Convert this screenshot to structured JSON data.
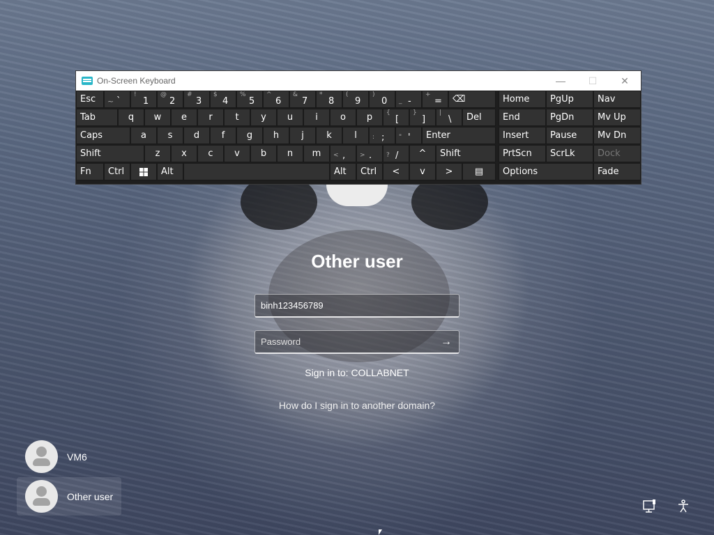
{
  "osk": {
    "title": "On-Screen Keyboard",
    "minimize": "—",
    "maximize": "☐",
    "close": "✕",
    "keys": {
      "esc": "Esc",
      "tilde_sub": "~",
      "tilde_main": "`",
      "k1_sub": "!",
      "k1": "1",
      "k2_sub": "@",
      "k2": "2",
      "k3_sub": "#",
      "k3": "3",
      "k4_sub": "$",
      "k4": "4",
      "k5_sub": "%",
      "k5": "5",
      "k6_sub": "^",
      "k6": "6",
      "k7_sub": "&",
      "k7": "7",
      "k8_sub": "*",
      "k8": "8",
      "k9_sub": "(",
      "k9": "9",
      "k0_sub": ")",
      "k0": "0",
      "minus_sub": "_",
      "minus": "-",
      "equals_sub": "+",
      "equals": "=",
      "backspace": "⌫",
      "home": "Home",
      "pgup": "PgUp",
      "nav": "Nav",
      "tab": "Tab",
      "q": "q",
      "w": "w",
      "e": "e",
      "r": "r",
      "t": "t",
      "y": "y",
      "u": "u",
      "i": "i",
      "o": "o",
      "p": "p",
      "lbracket_sub": "{",
      "lbracket": "[",
      "rbracket_sub": "}",
      "rbracket": "]",
      "pipe_sub": "|",
      "backslash": "\\",
      "del": "Del",
      "end": "End",
      "pgdn": "PgDn",
      "mvup": "Mv Up",
      "caps": "Caps",
      "a": "a",
      "s": "s",
      "d": "d",
      "f": "f",
      "g": "g",
      "h": "h",
      "j": "j",
      "k": "k",
      "l": "l",
      "semi_sub": ":",
      "semi": ";",
      "quote_sub": "\"",
      "quote": "'",
      "enter": "Enter",
      "insert": "Insert",
      "pause": "Pause",
      "mvdn": "Mv Dn",
      "shift": "Shift",
      "z": "z",
      "x": "x",
      "c": "c",
      "v": "v",
      "b": "b",
      "n": "n",
      "m": "m",
      "comma_sub": "<",
      "comma": ",",
      "period_sub": ">",
      "period": ".",
      "slash_sub": "?",
      "slash": "/",
      "up": "^",
      "shift_r": "Shift",
      "prtscn": "PrtScn",
      "scrlk": "ScrLk",
      "dock": "Dock",
      "fn": "Fn",
      "ctrl": "Ctrl",
      "alt": "Alt",
      "alt_r": "Alt",
      "ctrl_r": "Ctrl",
      "left": "<",
      "down": "v",
      "right": ">",
      "menu": "▤",
      "options": "Options",
      "fade": "Fade"
    }
  },
  "signin": {
    "title": "Other user",
    "username_value": "binh123456789",
    "password_placeholder": "Password",
    "submit_arrow": "→",
    "domain_text": "Sign in to: COLLABNET",
    "other_domain_link": "How do I sign in to another domain?"
  },
  "users": [
    {
      "name": "VM6"
    },
    {
      "name": "Other user"
    }
  ],
  "corner": {
    "network_icon": "network-icon",
    "accessibility_icon": "accessibility-icon"
  }
}
